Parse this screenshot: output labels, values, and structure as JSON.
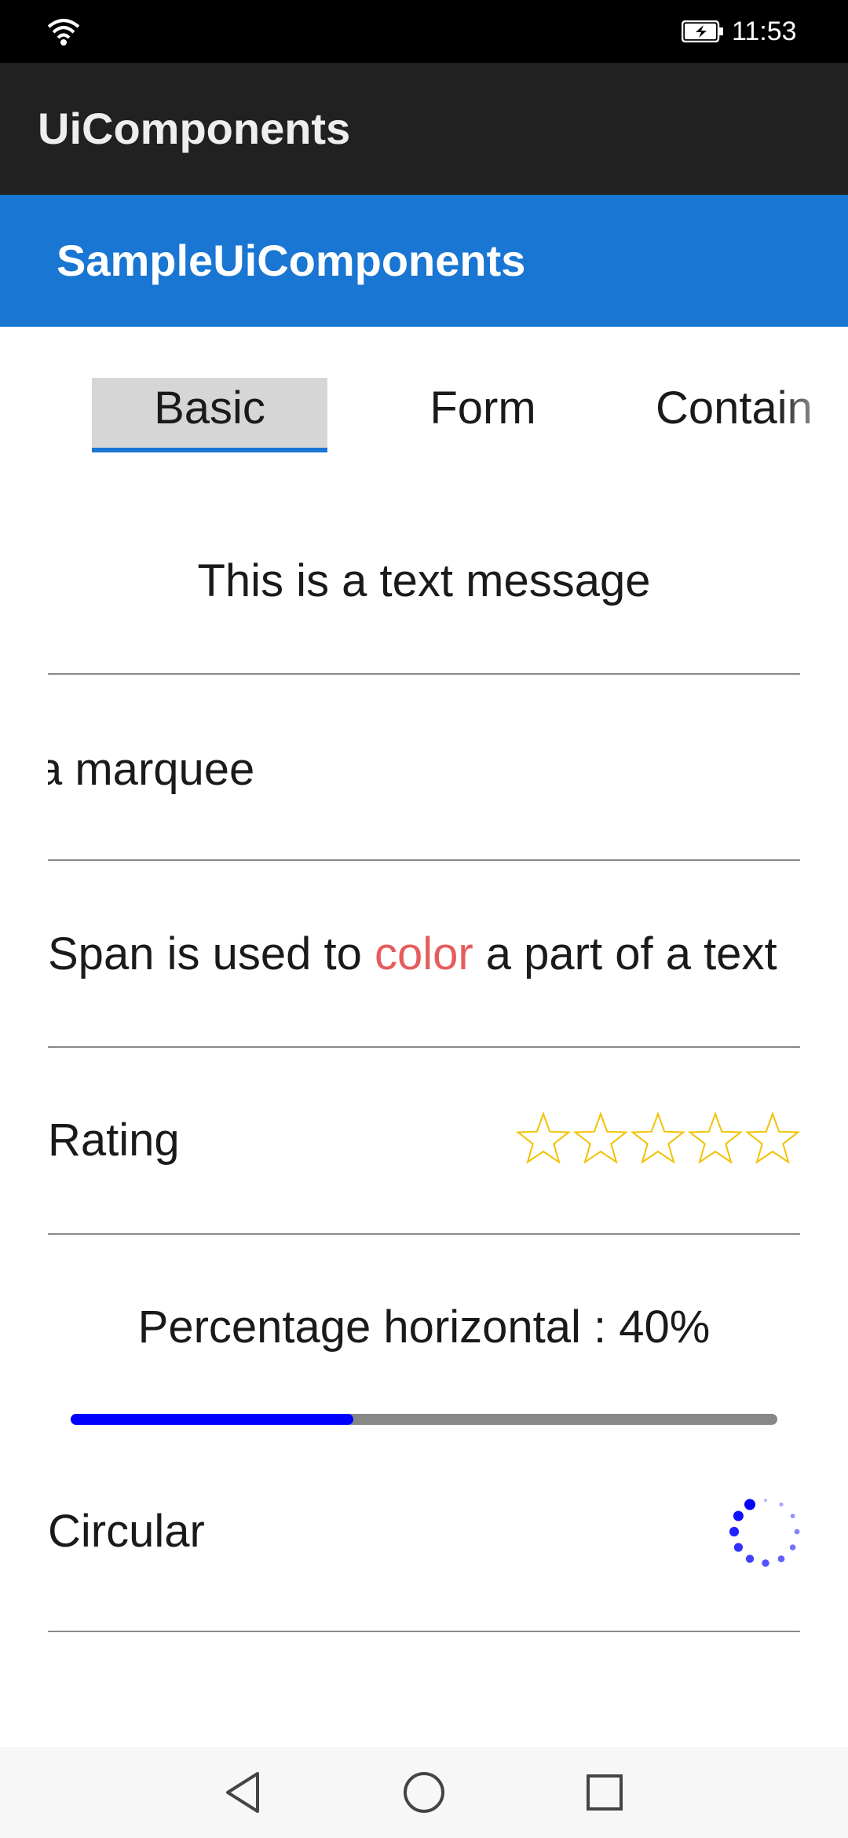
{
  "status_bar": {
    "time": "11:53",
    "wifi_icon": "wifi-icon",
    "battery_icon": "battery-charging-icon"
  },
  "app_bar": {
    "title": "UiComponents",
    "background": "#212121"
  },
  "sub_bar": {
    "title": "SampleUiComponents",
    "background": "#1976d2"
  },
  "tabs": [
    {
      "label": "Basic",
      "selected": true
    },
    {
      "label": "Form",
      "selected": false
    },
    {
      "label": "Contain",
      "selected": false
    }
  ],
  "basic": {
    "text_message": "This is a text message",
    "marquee_text": "a marquee",
    "span": {
      "before": "Span is used to ",
      "colored": "color",
      "after": " a part of a text",
      "colored_hex": "#e65c5c"
    },
    "rating": {
      "label": "Rating",
      "max": 5,
      "value": 0,
      "star_color": "#f2c200"
    },
    "percentage": {
      "label": "Percentage horizontal : 40%",
      "value": 0.4,
      "fill_color": "#0000ff",
      "track_color": "#888888"
    },
    "circular": {
      "label": "Circular",
      "color": "#0000ff"
    }
  },
  "nav_bar": {
    "back_icon": "back-triangle-icon",
    "home_icon": "home-circle-icon",
    "recents_icon": "recents-square-icon"
  }
}
